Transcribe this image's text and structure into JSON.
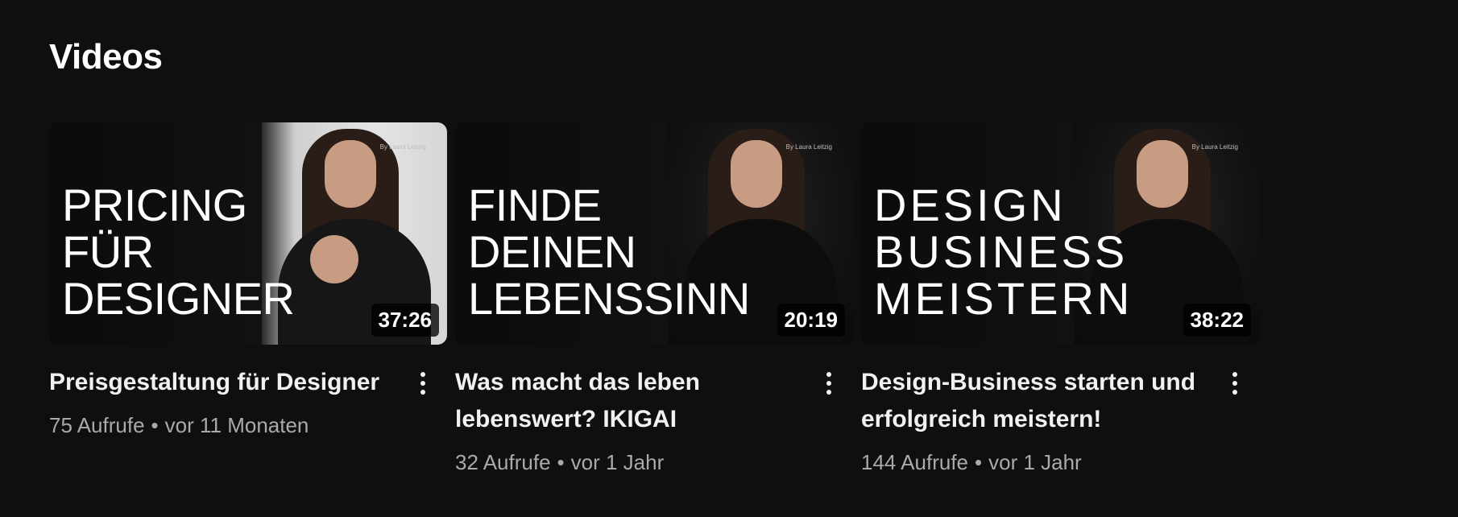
{
  "section": {
    "title": "Videos"
  },
  "videos": [
    {
      "thumbnail_lines": [
        "PRICING",
        "FÜR",
        "DESIGNER"
      ],
      "byline": "By Laura Leitzig",
      "duration": "37:26",
      "title": "Preisgestaltung für Designer",
      "views": "75 Aufrufe",
      "age": "vor 11 Monaten",
      "menu_icon": "more-vert-icon"
    },
    {
      "thumbnail_lines": [
        "FINDE",
        "DEINEN",
        "LEBENSSINN"
      ],
      "byline": "By Laura Leitzig",
      "duration": "20:19",
      "title": "Was macht das leben lebenswert? IKIGAI",
      "views": "32 Aufrufe",
      "age": "vor 1 Jahr",
      "menu_icon": "more-vert-icon"
    },
    {
      "thumbnail_lines": [
        "DESIGN",
        "BUSINESS",
        "MEISTERN"
      ],
      "byline": "By Laura Leitzig",
      "duration": "38:22",
      "title": "Design-Business starten und erfolgreich meistern!",
      "views": "144 Aufrufe",
      "age": "vor 1 Jahr",
      "menu_icon": "more-vert-icon"
    }
  ],
  "separator": "•"
}
